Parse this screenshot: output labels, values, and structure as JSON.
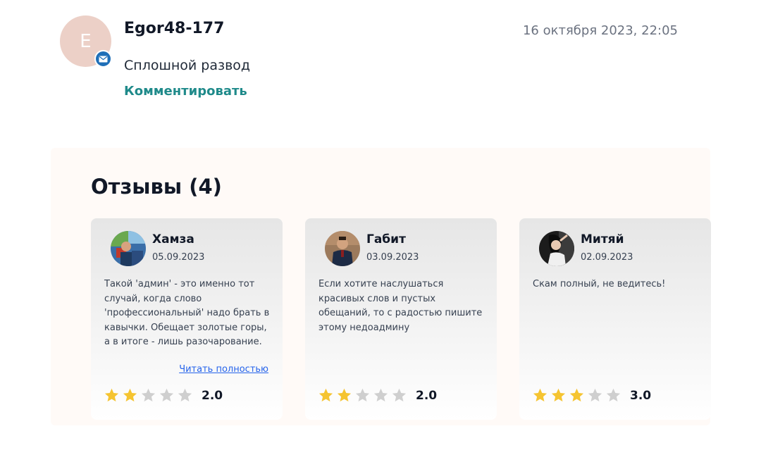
{
  "comment": {
    "avatar_letter": "E",
    "username": "Egor48-177",
    "date": "16 октября 2023, 22:05",
    "text": "Сплошной развод",
    "reply_label": "Комментировать"
  },
  "reviews": {
    "title": "Отзывы (4)",
    "read_more_label": "Читать полностью",
    "items": [
      {
        "name": "Хамза",
        "date": "05.09.2023",
        "text": "Такой 'админ' - это именно тот случай, когда слово 'профессиональный' надо брать в кавычки. Обещает золотые горы, а в итоге - лишь разочарование.",
        "rating": 2,
        "rating_label": "2.0"
      },
      {
        "name": "Габит",
        "date": "03.09.2023",
        "text": "Если хотите наслушаться красивых слов и пустых обещаний, то с радостью пишите этому недоадмину",
        "rating": 2,
        "rating_label": "2.0"
      },
      {
        "name": "Митяй",
        "date": "02.09.2023",
        "text": "Скам полный, не ведитесь!",
        "rating": 3,
        "rating_label": "3.0"
      }
    ]
  },
  "colors": {
    "star_filled": "#f5c431",
    "star_empty": "#cfcfcf",
    "link": "#1f8a8a",
    "avatar_bg": "#ecd0c7",
    "badge": "#1f6fb8"
  }
}
